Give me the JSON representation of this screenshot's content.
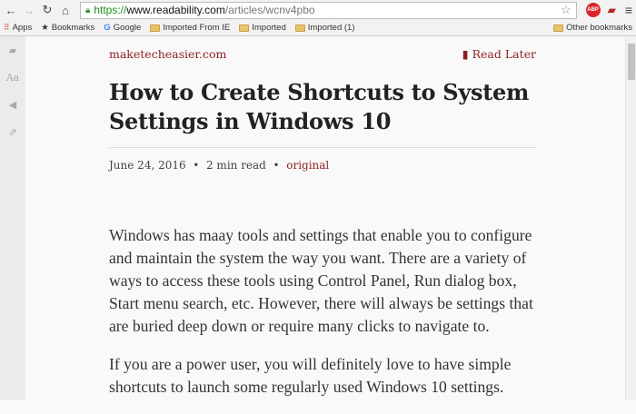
{
  "browser": {
    "url_scheme": "https://",
    "url_host": "www.readability.com",
    "url_path": "/articles/wcnv4pbo",
    "abp_label": "ABP"
  },
  "bookmarks": {
    "items": [
      "Apps",
      "Bookmarks",
      "Google",
      "Imported From IE",
      "Imported",
      "Imported (1)"
    ],
    "other": "Other bookmarks"
  },
  "sidebar": {
    "icons": [
      "readability-icon",
      "font-icon",
      "megaphone-icon",
      "share-icon"
    ],
    "font_label": "Aa"
  },
  "article": {
    "site": "maketecheasier.com",
    "read_later": "Read Later",
    "title": "How to Create Shortcuts to System Settings in Windows 10",
    "date": "June 24, 2016",
    "read_time": "2 min read",
    "original": "original",
    "sep": "•",
    "paragraphs": [
      "Windows has maay tools and settings that enable you to configure and maintain the system the way you want. There are a variety of ways to access these tools using Control Panel, Run dialog box, Start menu search, etc. However, there will always be settings that are buried deep down or require many clicks to navigate to.",
      "If you are a power user, you will definitely love to have simple shortcuts to launch some regularly used Windows 10 settings."
    ]
  }
}
